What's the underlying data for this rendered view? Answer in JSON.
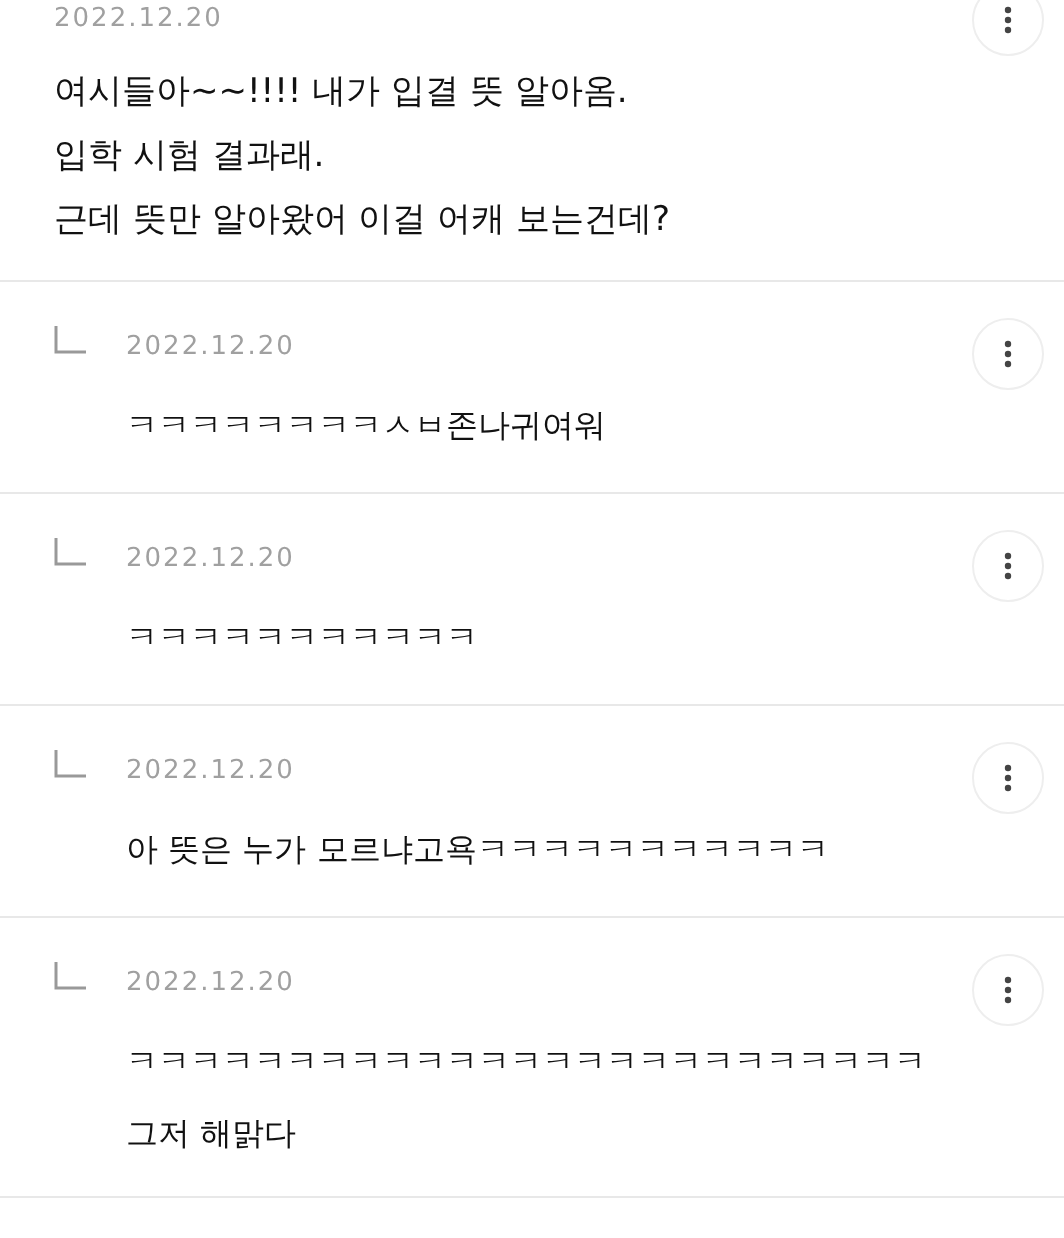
{
  "post": {
    "date": "2022.12.20",
    "lines": [
      "여시들아~~!!!! 내가 입결 뜻 알아옴.",
      "입학 시험 결과래.",
      "근데 뜻만 알아왔어 이걸 어캐 보는건데?"
    ]
  },
  "replies": [
    {
      "date": "2022.12.20",
      "text": "ㅋㅋㅋㅋㅋㅋㅋㅋㅅㅂ존나귀여워"
    },
    {
      "date": "2022.12.20",
      "text": "ㅋㅋㅋㅋㅋㅋㅋㅋㅋㅋㅋ"
    },
    {
      "date": "2022.12.20",
      "text": "아 뜻은 누가 모르냐고욕ㅋㅋㅋㅋㅋㅋㅋㅋㅋㅋㅋ"
    },
    {
      "date": "2022.12.20",
      "text": "ㅋㅋㅋㅋㅋㅋㅋㅋㅋㅋㅋㅋㅋㅋㅋㅋㅋㅋㅋㅋㅋㅋㅋㅋㅋ그저 해맑다"
    }
  ]
}
